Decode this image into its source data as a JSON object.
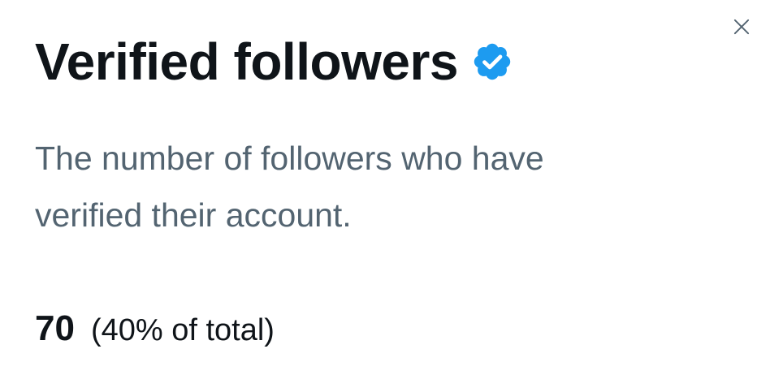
{
  "dialog": {
    "title": "Verified followers",
    "title_badge_icon": "verified-check-icon",
    "badge_color": "#1d9bf0",
    "close_icon": "close-icon",
    "description": "The number of followers who have verified their account.",
    "stat": {
      "value": "70",
      "percent_text": "(40% of total)"
    }
  }
}
